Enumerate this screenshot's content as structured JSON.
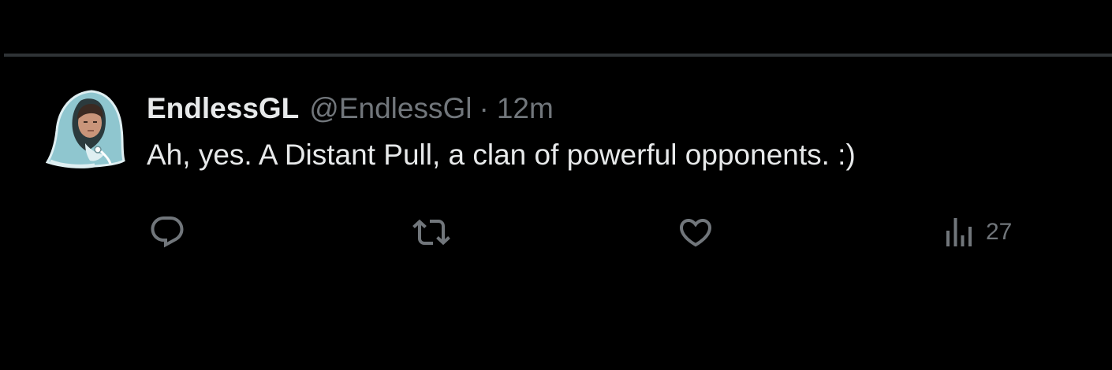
{
  "tweet": {
    "author_name": "EndlessGL",
    "author_handle": "@EndlessGl",
    "separator": "·",
    "timestamp": "12m",
    "text": "Ah, yes. A Distant Pull, a clan of powerful opponents. :)",
    "avatar_icon": "hooded-character-avatar"
  },
  "actions": {
    "reply_icon": "reply-icon",
    "retweet_icon": "retweet-icon",
    "like_icon": "heart-icon",
    "views_icon": "views-chart-icon",
    "views_count": "27"
  },
  "colors": {
    "background": "#000000",
    "divider": "#2f3336",
    "primary_text": "#e7e9ea",
    "secondary_text": "#71767b",
    "avatar_hood": "#8fc6cf"
  }
}
